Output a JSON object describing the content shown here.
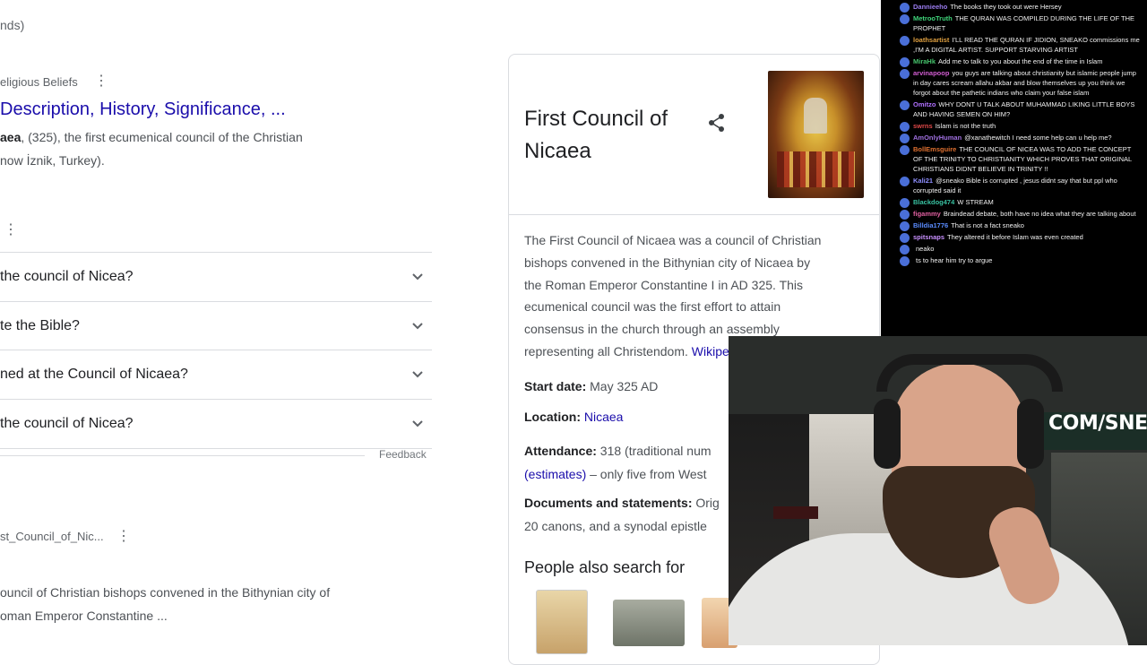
{
  "serp": {
    "top_fragment": "nds)",
    "result1": {
      "source": "eligious Beliefs",
      "title": "Description, History, Significance, ...",
      "snippet_line1_bold": "aea",
      "snippet_line1": ", (325), the first ecumenical council of the Christian",
      "snippet_line2": "now İznik, Turkey)."
    },
    "paa": [
      "the council of Nicea?",
      "te the Bible?",
      "ned at the Council of Nicaea?",
      "the council of Nicea?"
    ],
    "feedback": "Feedback",
    "result2": {
      "source": "st_Council_of_Nic...",
      "snippet_line1": "ouncil of Christian bishops convened in the Bithynian city of",
      "snippet_line2": "oman Emperor Constantine ..."
    }
  },
  "knowledge_panel": {
    "title_line1": "First Council of",
    "title_line2": "Nicaea",
    "desc": [
      "The First Council of Nicaea was a council of Christian",
      "bishops convened in the Bithynian city of Nicaea by",
      "the Roman Emperor Constantine I in AD 325. This",
      "ecumenical council was the first effort to attain",
      "consensus in the church through an assembly",
      "representing all Christendom."
    ],
    "source_link": "Wikipedia",
    "facts": {
      "start_label": "Start date:",
      "start_value": "May 325 AD",
      "location_label": "Location:",
      "location_value": "Nicaea",
      "attendance_label": "Attendance:",
      "attendance_value": "318 (traditional num",
      "attendance_link": "(estimates)",
      "attendance_rest": "– only five from West",
      "documents_label": "Documents and statements:",
      "documents_value": "Orig",
      "documents_line2": "20 canons, and a synodal epistle"
    },
    "people_also_search": "People also search for"
  },
  "chat": {
    "messages": [
      {
        "user": "Dannieeho",
        "color": "#9b7cf0",
        "text": "The books they took out were Hersey"
      },
      {
        "user": "MetrooTruth",
        "color": "#3fd47a",
        "text": "THE QURAN WAS COMPILED DURING THE LIFE OF THE PROPHET"
      },
      {
        "user": "loathsartist",
        "color": "#e0a040",
        "text": "I'LL READ THE QURAN IF JIDION, SNEAKO commissions me ,I'M A DIGITAL ARTIST. SUPPORT STARVING ARTIST"
      },
      {
        "user": "MiraHk",
        "color": "#46c46c",
        "text": "Add me to talk to you about the end of the time in Islam"
      },
      {
        "user": "arvinapoop",
        "color": "#d05cd0",
        "text": "you guys are talking about christianity but islamic people jump in day cares scream allahu akbar and blow themselves up you think we forgot about the pathetic indians who claim your false islam"
      },
      {
        "user": "Omitzo",
        "color": "#b070ff",
        "text": "WHY DONT U TALK ABOUT MUHAMMAD LIKING LITTLE BOYS AND HAVING SEMEN ON HIM?"
      },
      {
        "user": "swrns",
        "color": "#e04848",
        "text": "Islam is not the truth"
      },
      {
        "user": "AmOnlyHuman",
        "color": "#a070e0",
        "text": "@xanathewitch I need some help can u help me?"
      },
      {
        "user": "BollEmsguire",
        "color": "#e07030",
        "text": "THE COUNCIL OF NICEA WAS TO ADD THE CONCEPT OF THE TRINITY TO CHRISTIANITY WHICH PROVES THAT ORIGINAL CHRISTIANS DIDNT BELIEVE IN TRINITY !!"
      },
      {
        "user": "Kali21",
        "color": "#8f8fff",
        "text": "@sneako Bible is corrupted , jesus didnt say that but ppl who corrupted said it"
      },
      {
        "user": "Blackdog474",
        "color": "#38c0a0",
        "text": "W STREAM"
      },
      {
        "user": "figammy",
        "color": "#e060a0",
        "text": "Braindead debate, both have no idea what they are talking about"
      },
      {
        "user": "Billdia1776",
        "color": "#5a8cff",
        "text": "That is not a fact sneako"
      },
      {
        "user": "spitsnaps",
        "color": "#c890ff",
        "text": "They altered it before Islam was even created"
      },
      {
        "user": "",
        "color": "#8a8aff",
        "text": "neako"
      },
      {
        "user": "",
        "color": "#c0c0c0",
        "text": "ts to hear him try to argue"
      }
    ]
  },
  "webcam": {
    "overlay_text": "COM/SNEAKO"
  }
}
